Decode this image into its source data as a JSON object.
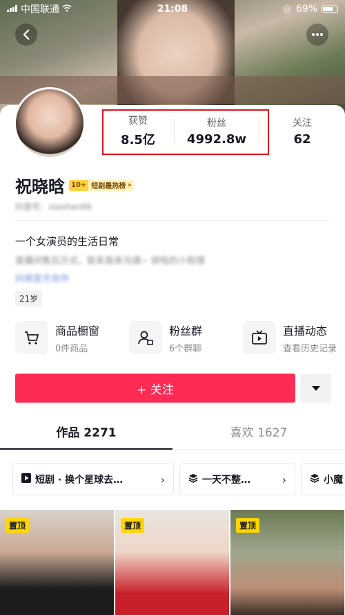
{
  "status_bar": {
    "carrier": "中国联通",
    "time": "21:08",
    "battery": "69%"
  },
  "profile": {
    "name": "祝晓晗",
    "rank_badge_num": "10+",
    "rank_badge_text": "短剧最热榜",
    "account_id": "抖音号：xiaohan66",
    "bio_line1": "一个女演员的生活日常",
    "bio_line2": "直播间售后方式，联系我来沟通~ 拼啦的小助理",
    "bio_line3": "抖商官方合作",
    "age": "21岁"
  },
  "stats": [
    {
      "label": "获赞",
      "value": "8.5亿"
    },
    {
      "label": "粉丝",
      "value": "4992.8w"
    },
    {
      "label": "关注",
      "value": "62"
    }
  ],
  "features": [
    {
      "title": "商品橱窗",
      "sub": "0件商品",
      "icon": "cart-icon"
    },
    {
      "title": "粉丝群",
      "sub": "6个群聊",
      "icon": "group-icon"
    },
    {
      "title": "直播动态",
      "sub": "查看历史记录",
      "icon": "live-icon"
    }
  ],
  "follow_button": "+ 关注",
  "tabs": [
    {
      "label": "作品 2271"
    },
    {
      "label": "喜欢 1627"
    }
  ],
  "collections": [
    {
      "label": "短剧 · 换个星球去…"
    },
    {
      "label": "一天不整…"
    },
    {
      "label": "小魔"
    }
  ],
  "pin_label": "置顶",
  "colors": {
    "accent": "#fe2c55",
    "highlight": "#e0141e",
    "pin": "#ffd600"
  }
}
